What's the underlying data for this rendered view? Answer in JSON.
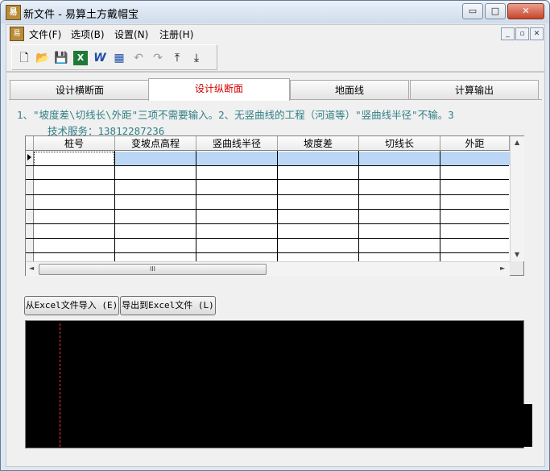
{
  "window": {
    "title": "新文件 - 易算土方戴帽宝",
    "app_icon_char": "易",
    "controls": {
      "minimize": "▭",
      "maximize": "□",
      "close": "✕"
    }
  },
  "menu": {
    "icon_char": "易",
    "items": [
      "文件(F)",
      "选项(B)",
      "设置(N)",
      "注册(H)"
    ],
    "mdi_controls": [
      "_",
      "▫",
      "✕"
    ]
  },
  "toolbar": {
    "buttons": [
      {
        "name": "new-file-icon",
        "glyph": "🗋"
      },
      {
        "name": "open-folder-icon",
        "glyph": "📂"
      },
      {
        "name": "save-icon",
        "glyph": "💾"
      },
      {
        "name": "excel-icon",
        "glyph": "X"
      },
      {
        "name": "word-icon",
        "glyph": "W"
      },
      {
        "name": "calculator-icon",
        "glyph": "▦"
      },
      {
        "name": "undo-icon",
        "glyph": "↶"
      },
      {
        "name": "redo-icon",
        "glyph": "↷"
      },
      {
        "name": "move-up-icon",
        "glyph": "⤒"
      },
      {
        "name": "move-down-icon",
        "glyph": "⤓"
      }
    ]
  },
  "tabs": [
    {
      "label": "设计横断面",
      "active": false
    },
    {
      "label": "设计纵断面",
      "active": true
    },
    {
      "label": "地面线",
      "active": false
    },
    {
      "label": "计算输出",
      "active": false
    }
  ],
  "notes": {
    "line1": "1、\"坡度差\\切线长\\外距\"三项不需要输入。2、无竖曲线的工程（河道等）\"竖曲线半径\"不输。3",
    "line2": "技术服务：13812287236"
  },
  "grid": {
    "columns": [
      "桩号",
      "变坡点高程",
      "竖曲线半径",
      "坡度差",
      "切线长",
      "外距"
    ],
    "rows": [
      [
        "",
        "",
        "",
        "",
        "",
        ""
      ],
      [
        "",
        "",
        "",
        "",
        "",
        ""
      ],
      [
        "",
        "",
        "",
        "",
        "",
        ""
      ],
      [
        "",
        "",
        "",
        "",
        "",
        ""
      ],
      [
        "",
        "",
        "",
        "",
        "",
        ""
      ],
      [
        "",
        "",
        "",
        "",
        "",
        ""
      ],
      [
        "",
        "",
        "",
        "",
        "",
        ""
      ]
    ],
    "scroll_thumb_label": "III",
    "scroll_arrows": {
      "up": "▲",
      "down": "▼",
      "left": "◄",
      "right": "►"
    }
  },
  "buttons": {
    "import": "从Excel文件导入 (E)",
    "export": "导出到Excel文件 (L)"
  },
  "colors": {
    "active_tab_text": "#d40000",
    "note_text": "#2f7f86",
    "selected_row": "#bcd7f5",
    "canvas_bg": "#000000",
    "center_line": "#ff3a3a"
  }
}
